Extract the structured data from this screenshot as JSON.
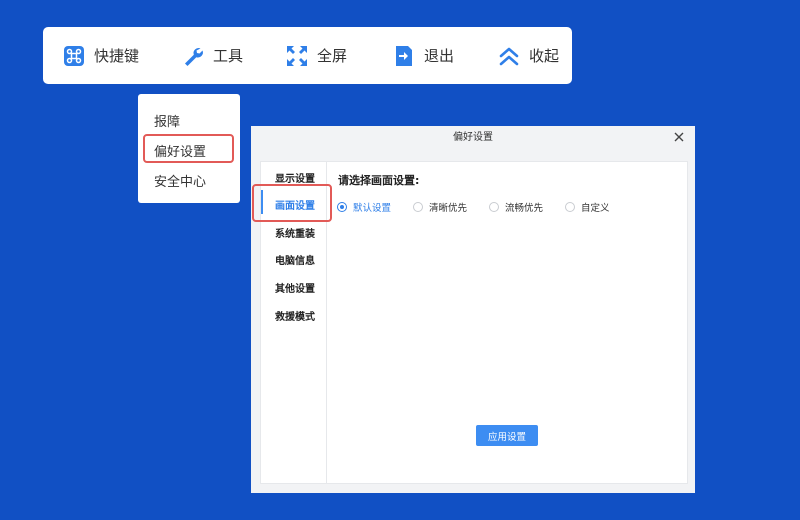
{
  "toolbar": {
    "items": [
      {
        "label": "快捷键",
        "icon": "command-icon"
      },
      {
        "label": "工具",
        "icon": "wrench-icon"
      },
      {
        "label": "全屏",
        "icon": "fullscreen-icon"
      },
      {
        "label": "退出",
        "icon": "exit-icon"
      },
      {
        "label": "收起",
        "icon": "collapse-up-icon"
      }
    ]
  },
  "dropdown": {
    "items": [
      {
        "label": "报障"
      },
      {
        "label": "偏好设置",
        "highlighted": true
      },
      {
        "label": "安全中心"
      }
    ]
  },
  "dialog": {
    "title": "偏好设置",
    "sidebar": {
      "items": [
        {
          "label": "显示设置"
        },
        {
          "label": "画面设置",
          "active": true
        },
        {
          "label": "系统重装"
        },
        {
          "label": "电脑信息"
        },
        {
          "label": "其他设置"
        },
        {
          "label": "救援模式"
        }
      ]
    },
    "content": {
      "title": "请选择画面设置:",
      "options": [
        {
          "label": "默认设置",
          "checked": true
        },
        {
          "label": "清晰优先",
          "checked": false
        },
        {
          "label": "流畅优先",
          "checked": false
        },
        {
          "label": "自定义",
          "checked": false
        }
      ],
      "apply_label": "应用设置"
    }
  },
  "colors": {
    "background": "#1150c4",
    "accent": "#3d8df2",
    "highlight_border": "#e25a57"
  }
}
